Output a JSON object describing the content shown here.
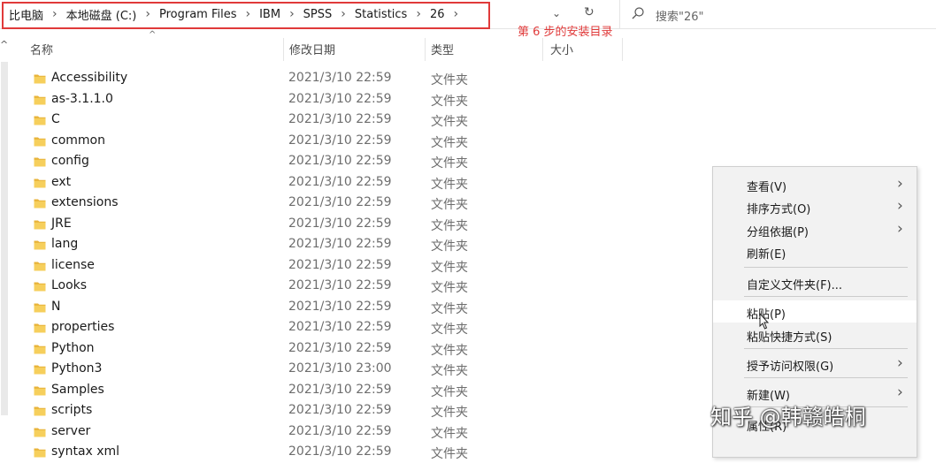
{
  "address": {
    "crumbs": [
      "比电脑",
      "本地磁盘 (C:)",
      "Program Files",
      "IBM",
      "SPSS",
      "Statistics",
      "26"
    ],
    "annotation": "第 6 步的安装目录"
  },
  "search": {
    "placeholder": "搜索\"26\""
  },
  "columns": {
    "name": "名称",
    "date": "修改日期",
    "type": "类型",
    "size": "大小"
  },
  "files": [
    {
      "name": "Accessibility",
      "date": "2021/3/10 22:59",
      "type": "文件夹"
    },
    {
      "name": "as-3.1.1.0",
      "date": "2021/3/10 22:59",
      "type": "文件夹"
    },
    {
      "name": "C",
      "date": "2021/3/10 22:59",
      "type": "文件夹"
    },
    {
      "name": "common",
      "date": "2021/3/10 22:59",
      "type": "文件夹"
    },
    {
      "name": "config",
      "date": "2021/3/10 22:59",
      "type": "文件夹"
    },
    {
      "name": "ext",
      "date": "2021/3/10 22:59",
      "type": "文件夹"
    },
    {
      "name": "extensions",
      "date": "2021/3/10 22:59",
      "type": "文件夹"
    },
    {
      "name": "JRE",
      "date": "2021/3/10 22:59",
      "type": "文件夹"
    },
    {
      "name": "lang",
      "date": "2021/3/10 22:59",
      "type": "文件夹"
    },
    {
      "name": "license",
      "date": "2021/3/10 22:59",
      "type": "文件夹"
    },
    {
      "name": "Looks",
      "date": "2021/3/10 22:59",
      "type": "文件夹"
    },
    {
      "name": "N",
      "date": "2021/3/10 22:59",
      "type": "文件夹"
    },
    {
      "name": "properties",
      "date": "2021/3/10 22:59",
      "type": "文件夹"
    },
    {
      "name": "Python",
      "date": "2021/3/10 22:59",
      "type": "文件夹"
    },
    {
      "name": "Python3",
      "date": "2021/3/10 23:00",
      "type": "文件夹"
    },
    {
      "name": "Samples",
      "date": "2021/3/10 22:59",
      "type": "文件夹"
    },
    {
      "name": "scripts",
      "date": "2021/3/10 22:59",
      "type": "文件夹"
    },
    {
      "name": "server",
      "date": "2021/3/10 22:59",
      "type": "文件夹"
    },
    {
      "name": "syntax xml",
      "date": "2021/3/10 22:59",
      "type": "文件夹"
    }
  ],
  "context_menu": {
    "view": "查看(V)",
    "sort": "排序方式(O)",
    "group": "分组依据(P)",
    "refresh": "刷新(E)",
    "customize": "自定义文件夹(F)...",
    "paste": "粘贴(P)",
    "paste_shortcut": "粘贴快捷方式(S)",
    "grant_access": "授予访问权限(G)",
    "new": "新建(W)",
    "properties": "属性(R)"
  },
  "watermark": "知乎 @韩赣皓桐",
  "colors": {
    "annotation_red": "#e03a3a",
    "folder_yellow": "#f2c94c",
    "menu_bg": "#f2f2f2"
  }
}
